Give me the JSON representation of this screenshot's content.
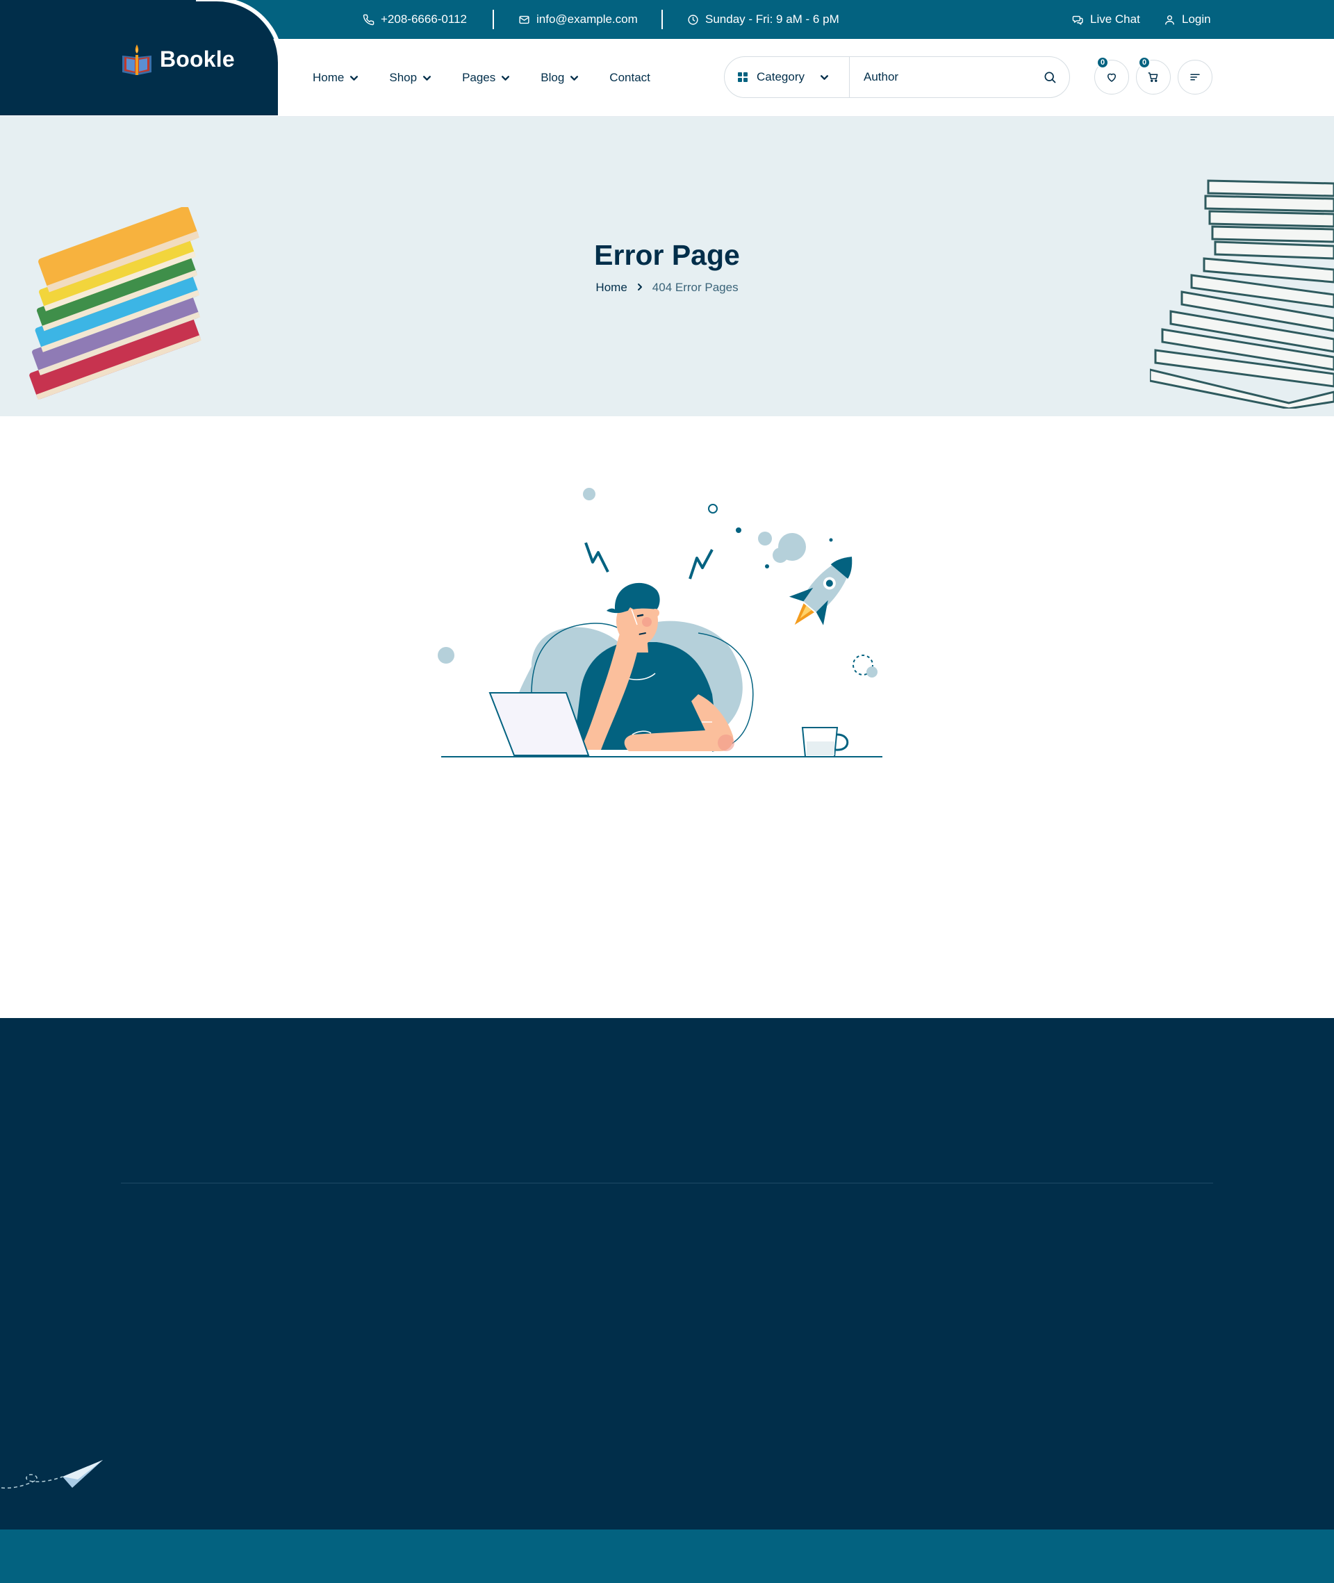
{
  "topbar": {
    "phone": "+208-6666-0112",
    "email": "info@example.com",
    "hours": "Sunday - Fri: 9 aM - 6 pM",
    "live_chat": "Live Chat",
    "login": "Login"
  },
  "brand": {
    "name": "Bookle"
  },
  "nav": {
    "items": [
      {
        "label": "Home",
        "dropdown": true
      },
      {
        "label": "Shop",
        "dropdown": true
      },
      {
        "label": "Pages",
        "dropdown": true
      },
      {
        "label": "Blog",
        "dropdown": true
      },
      {
        "label": "Contact",
        "dropdown": false
      }
    ]
  },
  "search": {
    "category_label": "Category",
    "placeholder": "Author"
  },
  "header_icons": {
    "wishlist_count": "0",
    "cart_count": "0"
  },
  "hero": {
    "title": "Error Page",
    "breadcrumb_home": "Home",
    "breadcrumb_current": "404 Error Pages"
  },
  "colors": {
    "navy": "#012e4a",
    "teal": "#036280",
    "hero_bg": "#e6eff2",
    "skin": "#fbbf9c",
    "light_blue": "#b5d0da"
  }
}
